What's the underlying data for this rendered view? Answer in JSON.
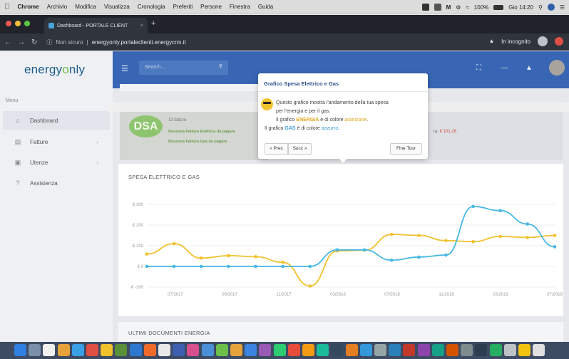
{
  "menubar": {
    "app": "Chrome",
    "items": [
      "Archivio",
      "Modifica",
      "Visualizza",
      "Cronologia",
      "Preferiti",
      "Persone",
      "Finestra",
      "Guida"
    ],
    "battery": "100%",
    "clock": "Gio 14:20"
  },
  "browser": {
    "tab_title": "Dashboard - PORTALE CLIENT",
    "security": "Non sicuro",
    "url": "energyonly.portaleclienti.energycrm.it",
    "incognito": "In incognito"
  },
  "header": {
    "logo_left": "energy",
    "logo_o": "o",
    "logo_right": "nly",
    "search_placeholder": "Search..."
  },
  "sidebar": {
    "heading": "Menu",
    "items": [
      {
        "label": "Dashboard",
        "icon": "home-icon"
      },
      {
        "label": "Fatture",
        "icon": "invoice-icon"
      },
      {
        "label": "Utenze",
        "icon": "meter-icon"
      },
      {
        "label": "Assistenza",
        "icon": "question-icon"
      }
    ]
  },
  "dsa": {
    "logo": "DSA",
    "fatture": "13 fatture",
    "note1": "Nessuna Fattura Elettrica da pagare",
    "note2": "Nessuna Fattura Gas da pagare",
    "amount_label": "ra:",
    "amount": "€ 101,26"
  },
  "tour": {
    "title": "Grafico Spesa Elettrico e Gas",
    "line1": "Questo grafico mostra l'andamento della tua spesa",
    "line2": "per l'energia e per il gas.",
    "line3_a": "Il grafico ",
    "line3_b": "ENERGIA",
    "line3_c": " è di colore ",
    "line3_d": "arancione",
    "line3_e": ".",
    "line4_a": "Il grafico ",
    "line4_b": "GAS",
    "line4_c": " è di colore ",
    "line4_d": "azzurro",
    "line4_e": ".",
    "prev": "« Prec",
    "next": "Succ »",
    "end": "Fine Tour"
  },
  "chart_title": "SPESA ELETTRICO E GAS",
  "docs_title": "ULTIMI DOCUMENTI ENERGIA",
  "colors": {
    "energia": "#f2c12e",
    "gas": "#46b8e3",
    "header": "#3866b4"
  },
  "chart_data": {
    "type": "line",
    "title": "SPESA ELETTRICO E GAS",
    "x_tick_labels": [
      "07/2017",
      "09/2017",
      "11/2017",
      "03/2018",
      "07/2018",
      "11/2018",
      "03/2019",
      "07/2019"
    ],
    "y_tick_labels": [
      "€ 300",
      "€ 200",
      "€ 100",
      "€ 0",
      "€ -100"
    ],
    "ylim": [
      -100,
      300
    ],
    "grid": true,
    "legend": "none",
    "series": [
      {
        "color": "#f2c12e",
        "values": [
          60,
          110,
          40,
          52,
          47,
          20,
          -95,
          75,
          78,
          155,
          150,
          125,
          120,
          145,
          140,
          150
        ]
      },
      {
        "color": "#46b8e3",
        "values": [
          0,
          0,
          0,
          0,
          0,
          0,
          0,
          80,
          80,
          30,
          45,
          55,
          290,
          270,
          205,
          95
        ]
      }
    ]
  }
}
